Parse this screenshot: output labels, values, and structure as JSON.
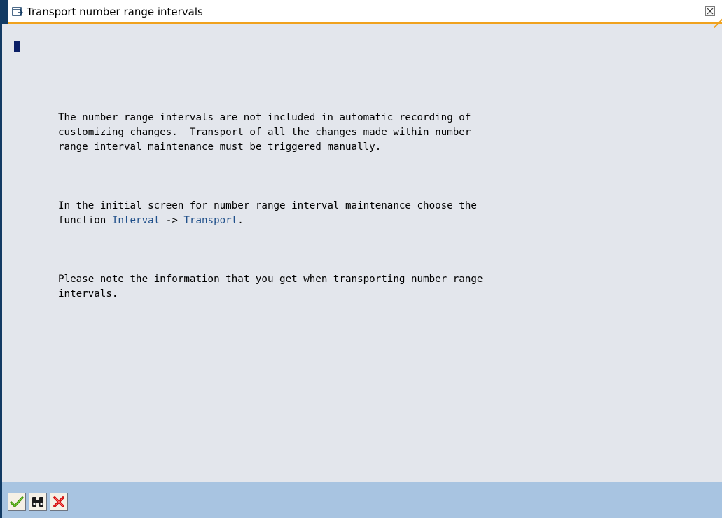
{
  "dialog": {
    "title": "Transport number range intervals",
    "icons": {
      "title": "window-icon",
      "close": "close-icon"
    }
  },
  "content": {
    "p1": [
      "The number range intervals are not included in automatic recording of",
      "customizing changes.  Transport of all the changes made within number",
      "range interval maintenance must be triggered manually."
    ],
    "p2": {
      "line1": "In the initial screen for number range interval maintenance choose the",
      "line2_prefix": "function ",
      "link1": "Interval",
      "arrow": " -> ",
      "link2": "Transport",
      "suffix": "."
    },
    "p3": [
      "Please note the information that you get when transporting number range",
      "intervals."
    ]
  },
  "footer": {
    "buttons": [
      {
        "name": "continue",
        "icon": "checkmark-icon",
        "color": "#3a8f00"
      },
      {
        "name": "find",
        "icon": "binoculars-icon",
        "color": "#000000"
      },
      {
        "name": "cancel",
        "icon": "x-icon",
        "color": "#cc0000"
      }
    ]
  },
  "colors": {
    "border": "#123a63",
    "accent": "#f0a21e",
    "background": "#e3e6ec",
    "footer": "#a8c4e1",
    "link": "#1f4f8a"
  }
}
